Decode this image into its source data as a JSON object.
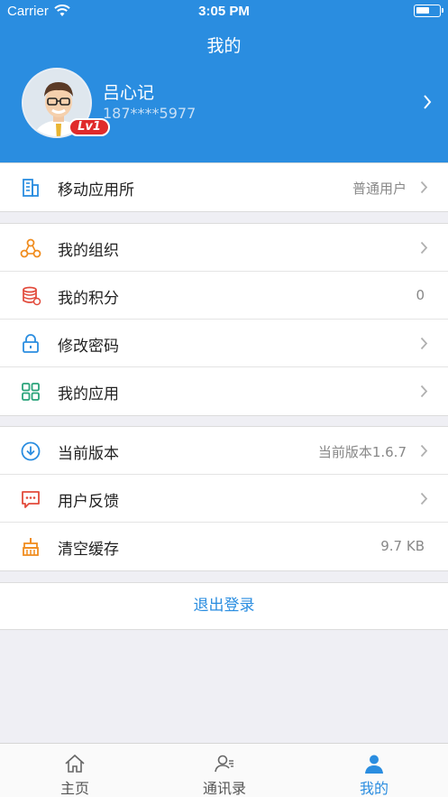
{
  "status_bar": {
    "carrier": "Carrier",
    "time": "3:05 PM"
  },
  "nav": {
    "title": "我的"
  },
  "profile": {
    "name": "吕心记",
    "phone": "187****5977",
    "level": "Lv1"
  },
  "sections": [
    [
      {
        "label": "移动应用所",
        "value": "普通用户",
        "chevron": true,
        "icon": "building-icon"
      }
    ],
    [
      {
        "label": "我的组织",
        "value": "",
        "chevron": true,
        "icon": "organization-icon"
      },
      {
        "label": "我的积分",
        "value": "0",
        "chevron": false,
        "icon": "points-icon"
      },
      {
        "label": "修改密码",
        "value": "",
        "chevron": true,
        "icon": "lock-icon"
      },
      {
        "label": "我的应用",
        "value": "",
        "chevron": true,
        "icon": "apps-grid-icon"
      }
    ],
    [
      {
        "label": "当前版本",
        "value": "当前版本1.6.7",
        "chevron": true,
        "icon": "download-icon"
      },
      {
        "label": "用户反馈",
        "value": "",
        "chevron": true,
        "icon": "feedback-icon"
      },
      {
        "label": "清空缓存",
        "value": "9.7 KB",
        "chevron": false,
        "icon": "broom-icon"
      }
    ]
  ],
  "logout_label": "退出登录",
  "tabs": [
    {
      "label": "主页",
      "icon": "home-icon"
    },
    {
      "label": "通讯录",
      "icon": "contacts-icon"
    },
    {
      "label": "我的",
      "icon": "person-icon",
      "active": true
    }
  ],
  "colors": {
    "primary": "#2a8de0",
    "badge": "#e02b2b",
    "icon_blue": "#2a8de0",
    "icon_orange": "#f08c1e",
    "icon_red": "#e24a3b",
    "icon_green": "#29a37a"
  }
}
